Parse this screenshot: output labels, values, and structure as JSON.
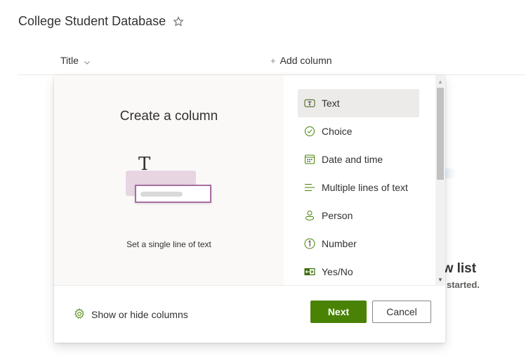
{
  "page": {
    "title": "College Student Database",
    "favorite_icon": "star-outline-icon"
  },
  "list_header": {
    "columns": [
      {
        "label": "Title",
        "icon": "chevron-down-icon"
      }
    ],
    "add_column_label": "Add column",
    "add_column_icon": "plus-icon"
  },
  "empty_state": {
    "title_fragment": "ew list",
    "subtitle_fragment": "started."
  },
  "create_column_panel": {
    "title": "Create a column",
    "preview_description": "Set a single line of text",
    "column_types": [
      {
        "label": "Text",
        "icon": "text-box-icon",
        "selected": true
      },
      {
        "label": "Choice",
        "icon": "check-circle-icon",
        "selected": false
      },
      {
        "label": "Date and time",
        "icon": "calendar-icon",
        "selected": false
      },
      {
        "label": "Multiple lines of text",
        "icon": "text-lines-icon",
        "selected": false
      },
      {
        "label": "Person",
        "icon": "person-icon",
        "selected": false
      },
      {
        "label": "Number",
        "icon": "number-circle-icon",
        "selected": false
      },
      {
        "label": "Yes/No",
        "icon": "toggle-icon",
        "selected": false
      }
    ],
    "footer": {
      "show_hide_label": "Show or hide columns",
      "next_label": "Next",
      "cancel_label": "Cancel"
    },
    "colors": {
      "accent": "#498205",
      "icon_green": "#498205",
      "selected_bg": "#edebe9",
      "preview_bg": "#faf9f8",
      "illustration_pink": "#e8d5e2",
      "illustration_border": "#a86fa3"
    }
  }
}
